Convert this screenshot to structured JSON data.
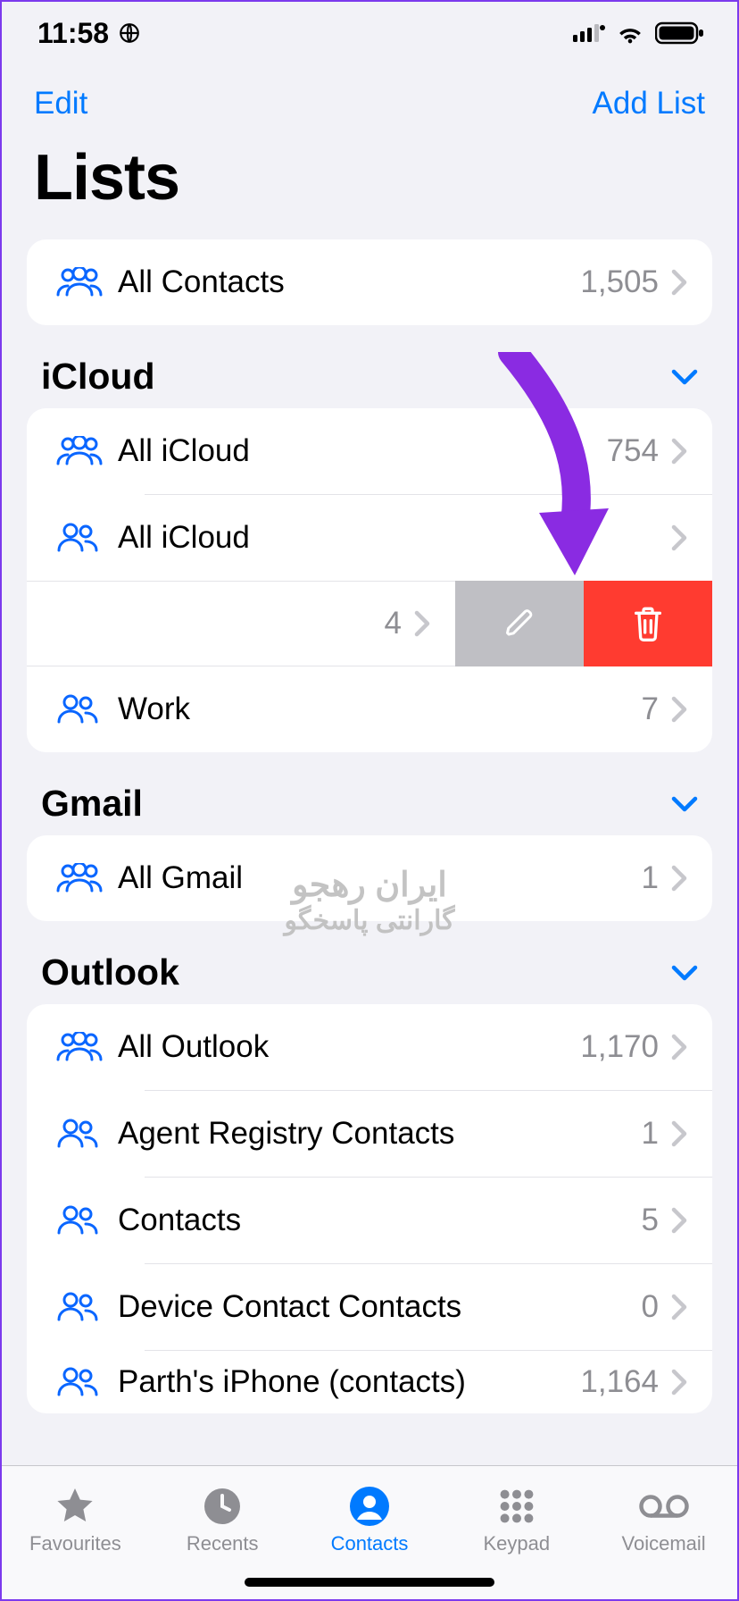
{
  "status": {
    "time": "11:58"
  },
  "nav": {
    "edit": "Edit",
    "add": "Add List"
  },
  "title": "Lists",
  "all_contacts": {
    "label": "All Contacts",
    "count": "1,505"
  },
  "sections": {
    "icloud": {
      "title": "iCloud",
      "rows": {
        "all": {
          "label": "All iCloud",
          "count": "754"
        },
        "all2": {
          "label": "All iCloud",
          "count": ""
        },
        "swiped": {
          "label": "",
          "count": "4"
        },
        "work": {
          "label": "Work",
          "count": "7"
        }
      }
    },
    "gmail": {
      "title": "Gmail",
      "rows": {
        "all": {
          "label": "All Gmail",
          "count": "1"
        }
      }
    },
    "outlook": {
      "title": "Outlook",
      "rows": {
        "all": {
          "label": "All Outlook",
          "count": "1,170"
        },
        "agent": {
          "label": "Agent Registry Contacts",
          "count": "1"
        },
        "contacts": {
          "label": "Contacts",
          "count": "5"
        },
        "device": {
          "label": "Device Contact Contacts",
          "count": "0"
        },
        "parth": {
          "label": "Parth's iPhone (contacts)",
          "count": "1,164"
        }
      }
    }
  },
  "tabs": {
    "favourites": "Favourites",
    "recents": "Recents",
    "contacts": "Contacts",
    "keypad": "Keypad",
    "voicemail": "Voicemail"
  },
  "watermark": {
    "line1": "ایران رهجو",
    "line2": "گارانتی پاسخگو"
  }
}
